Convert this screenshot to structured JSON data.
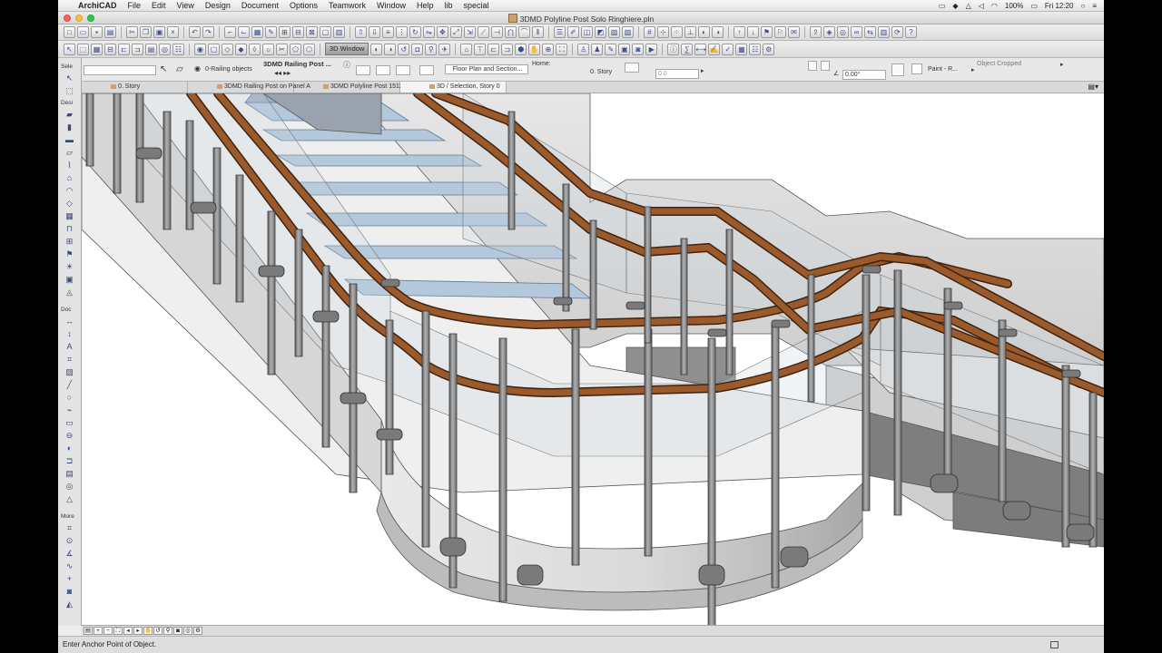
{
  "menubar": {
    "app_name": "ArchiCAD",
    "items": [
      "File",
      "Edit",
      "View",
      "Design",
      "Document",
      "Options",
      "Teamwork",
      "Window",
      "Help",
      "lib",
      "special"
    ],
    "battery": "100%",
    "clock": "Fri 12:20"
  },
  "window": {
    "title": "3DMD Polyline Post Solo Ringhiere.pln"
  },
  "toolbar2": {
    "window_3d_label": "3D Window"
  },
  "infobox": {
    "layer_label": "0-Railing objects",
    "object_name": "3DMD Railing Post ...",
    "floor_plan_btn": "Floor Plan and Section...",
    "home_label": "Home:",
    "story_value": "0. Story",
    "elev_label": "0.0",
    "angle_value": "0.00°",
    "material_value": "Paint - R...",
    "status_right": "Object Cropped"
  },
  "toolbox": {
    "sections": [
      "Sele",
      "Desi",
      "Doc",
      "More"
    ]
  },
  "tabs": [
    {
      "label": "0. Story"
    },
    {
      "label": "3DMD Railing Post on Panel A"
    },
    {
      "label": "3DMD Polyline Post 1512"
    },
    {
      "label": "3D / Selection, Story 0"
    }
  ],
  "statusbar": {
    "text": "Enter Anchor Point of Object."
  },
  "colors": {
    "handrail": "#9b5a2b",
    "glass": "#b4c8db",
    "post": "#8d8d8d",
    "wall": "#d4d4d4"
  }
}
